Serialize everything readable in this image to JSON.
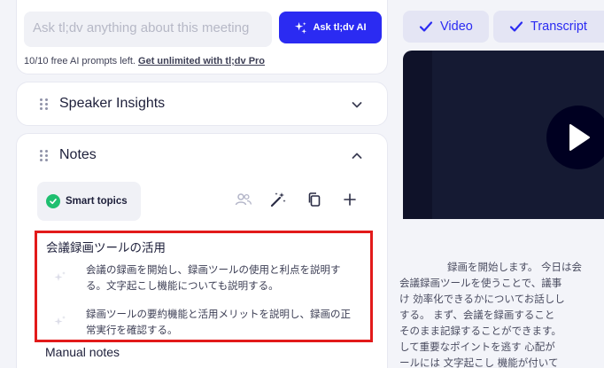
{
  "ask": {
    "placeholder": "Ask tl;dv anything about this meeting",
    "button_label": "Ask tl;dv AI",
    "prompts_left": "10/10 free AI prompts left.",
    "upgrade_link": "Get unlimited with tl;dv Pro"
  },
  "sections": {
    "speaker_insights": "Speaker Insights",
    "notes": "Notes"
  },
  "notes": {
    "smart_topics_label": "Smart topics",
    "topic_title": "会議録画ツールの活用",
    "bullets": [
      "会議の録画を開始し、録画ツールの使用と利点を説明する。文字起こし機能についても説明する。",
      "録画ツールの要約機能と活用メリットを説明し、録画の正常実行を確認する。"
    ],
    "manual_notes_label": "Manual notes"
  },
  "tabs": {
    "video": "Video",
    "transcript": "Transcript"
  },
  "transcript_lines": [
    "録画を開始します。 今日は会",
    "会議録画ツールを使うことで、議事",
    "け 効率化できるかについてお話しし",
    "する。 まず、会議を録画すること",
    "そのまま記録することができます。",
    "して重要なポイントを逃す 心配が",
    "ールには 文字起こし 機能が付いて"
  ],
  "colors": {
    "accent": "#2b2bf2",
    "highlight_border": "#e21a1a",
    "success": "#1fbf70"
  }
}
